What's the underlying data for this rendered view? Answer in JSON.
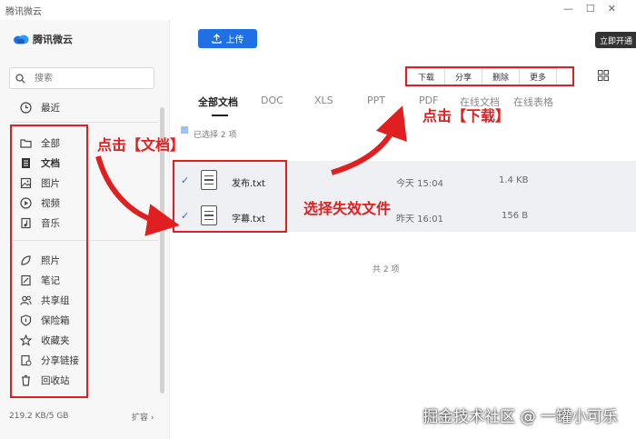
{
  "app": {
    "title": "腾讯微云",
    "logo_text": "腾讯微云",
    "window_controls": [
      "—",
      "☐",
      "✕"
    ]
  },
  "sidebar": {
    "search_placeholder": "搜索",
    "recent": "最近",
    "group1": [
      "全部",
      "文档",
      "图片",
      "视频",
      "音乐"
    ],
    "group2": [
      "照片",
      "笔记",
      "共享组",
      "保险箱",
      "收藏夹",
      "分享链接",
      "回收站"
    ],
    "storage": "219.2 KB/5 GB",
    "expand": "扩容 ›"
  },
  "toolbar": {
    "upload": "上传",
    "open_vip": "立即开通"
  },
  "actions": [
    "下载",
    "分享",
    "删除",
    "更多"
  ],
  "tabs": [
    "全部文档",
    "DOC",
    "XLS",
    "PPT",
    "PDF",
    "在线文档",
    "在线表格"
  ],
  "selected_text": "已选择 2 项",
  "files": [
    {
      "name": "发布.txt",
      "date": "今天 15:04",
      "size": "1.4 KB"
    },
    {
      "name": "字幕.txt",
      "date": "昨天 16:01",
      "size": "156 B"
    }
  ],
  "total": "共 2 项",
  "annotations": {
    "click_doc": "点击【文档】",
    "click_download": "点击【下载】",
    "select_files": "选择失效文件"
  },
  "watermark": "掘金技术社区 @ 一罐小可乐",
  "colors": {
    "accent": "#1f6fe5",
    "annotation_red": "#e02020"
  }
}
